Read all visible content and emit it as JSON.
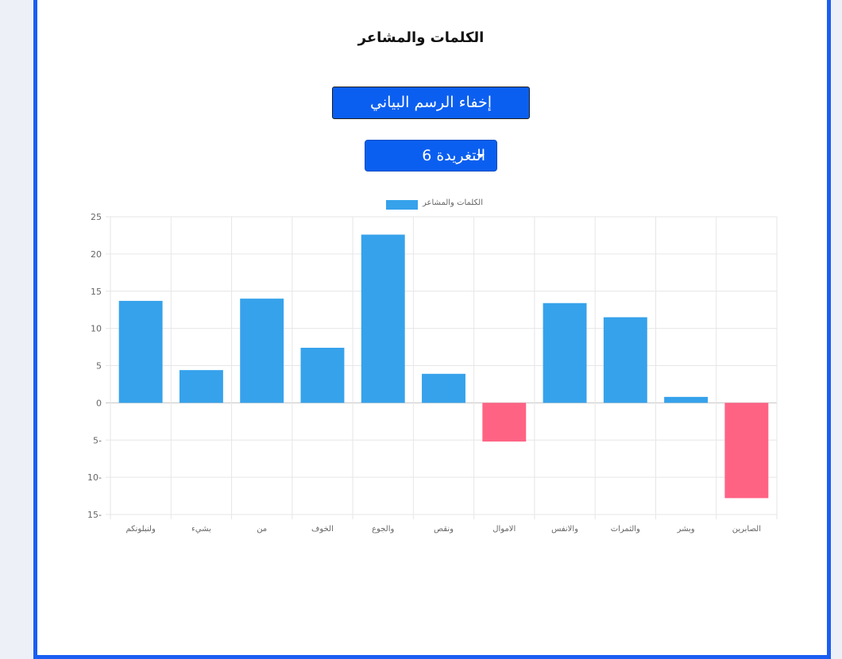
{
  "header": {
    "title": "الكلمات والمشاعر"
  },
  "controls": {
    "toggle_label": "إخفاء الرسم البياني",
    "dropdown_label": "التغريدة 6"
  },
  "colors": {
    "accent": "#0b5ff0",
    "positive": "#36a2eb",
    "negative": "#ff6384",
    "frame": "#1a5ef2"
  },
  "chart_data": {
    "type": "bar",
    "legend": "الكلمات والمشاعر",
    "legend_position": "top",
    "grid": true,
    "ylim": [
      -15,
      25
    ],
    "yticks": [
      25,
      20,
      15,
      10,
      5,
      0,
      -5,
      -10,
      -15
    ],
    "ytick_labels": [
      "25",
      "20",
      "15",
      "10",
      "5",
      "0",
      "5-",
      "10-",
      "15-"
    ],
    "categories": [
      "ولنبلونكم",
      "بشيء",
      "من",
      "الخوف",
      "والجوع",
      "ونقص",
      "الاموال",
      "والانفس",
      "والثمرات",
      "وبشر",
      "الصابرين"
    ],
    "values": [
      13.7,
      4.4,
      14.0,
      7.4,
      22.6,
      3.9,
      -5.2,
      13.4,
      11.5,
      0.8,
      -12.8
    ]
  }
}
